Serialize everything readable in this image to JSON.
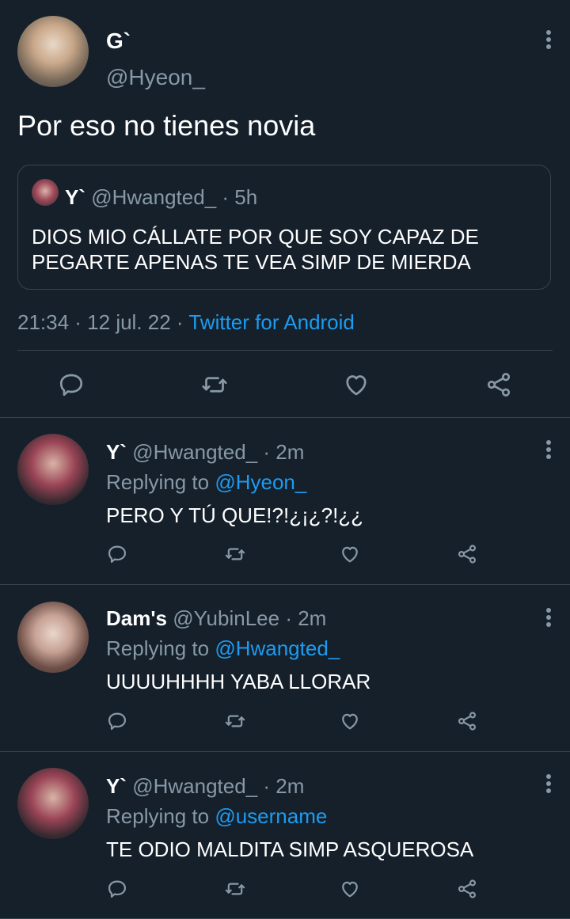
{
  "main_tweet": {
    "display_name": "G`",
    "handle": "@Hyeon_",
    "text": "Por eso no tienes novia",
    "quoted": {
      "display_name": "Y`",
      "handle": "@Hwangted_",
      "time": "· 5h",
      "text_line1": "DIOS MIO CÁLLATE POR QUE SOY CAPAZ DE",
      "text_line2": "PEGARTE APENAS TE VEA SIMP DE MIERDA"
    },
    "meta_time": "21:34 · 12 jul. 22 ·",
    "meta_source": "Twitter for Android"
  },
  "replies": [
    {
      "display_name": "Y`",
      "handle": "@Hwangted_",
      "time": "· 2m",
      "replying_label": "Replying to",
      "replying_to": "@Hyeon_",
      "text": "PERO Y TÚ QUE!?!¿¡¿?!¿¿"
    },
    {
      "display_name": "Dam's",
      "handle": "@YubinLee",
      "time": "· 2m",
      "replying_label": "Replying to",
      "replying_to": "@Hwangted_",
      "text": "UUUUHHHH YABA LLORAR"
    },
    {
      "display_name": "Y`",
      "handle": "@Hwangted_",
      "time": "· 2m",
      "replying_label": "Replying to",
      "replying_to": "@username",
      "text": "TE ODIO MALDITA SIMP ASQUEROSA"
    }
  ],
  "colors": {
    "background": "#15202b",
    "muted": "#8899a6",
    "link": "#1d9bf0",
    "divider": "#38444d"
  },
  "icons": [
    "more-vertical-icon",
    "reply-icon",
    "retweet-icon",
    "like-icon",
    "share-icon"
  ]
}
